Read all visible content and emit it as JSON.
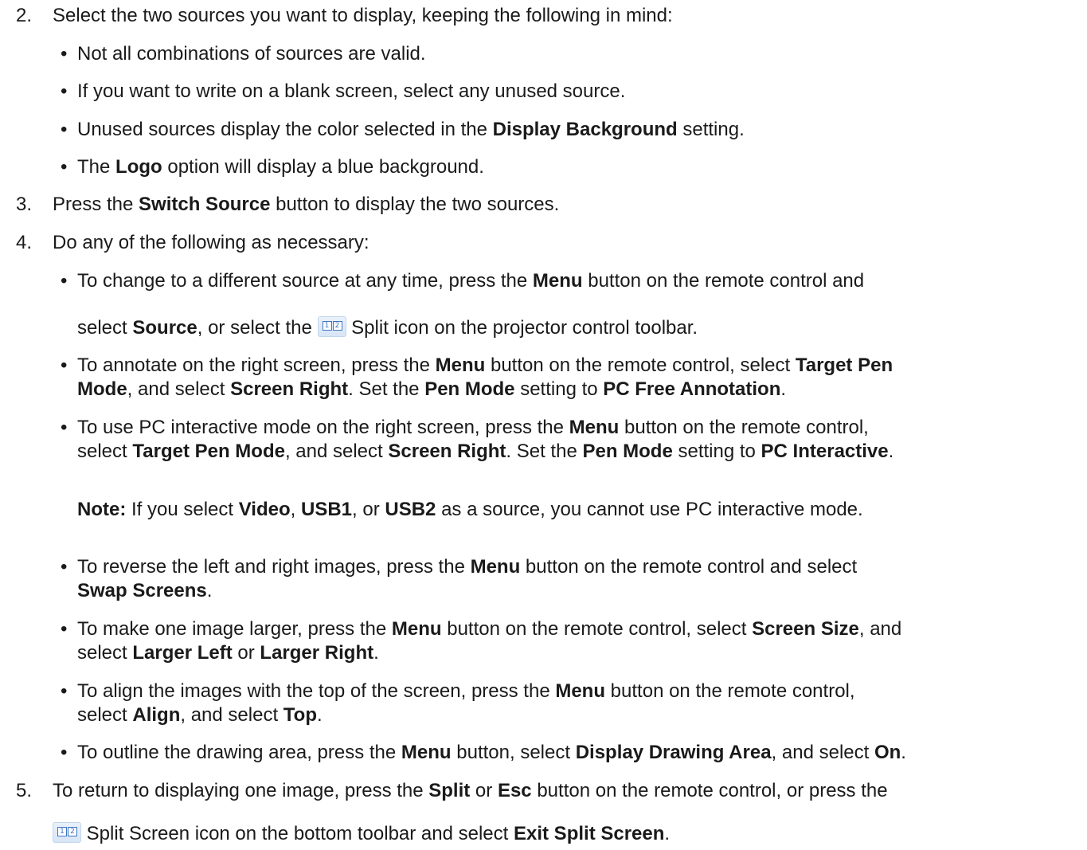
{
  "steps": [
    {
      "number": "2.",
      "parts": [
        {
          "t": "Select the two sources you want to display, keeping the following in mind:"
        }
      ]
    },
    {
      "number": "3.",
      "parts": [
        {
          "t": "Press the "
        },
        {
          "t": "Switch Source",
          "b": true
        },
        {
          "t": " button to display the two sources."
        }
      ]
    },
    {
      "number": "4.",
      "parts": [
        {
          "t": "Do any of the following as necessary:"
        }
      ]
    },
    {
      "number": "5.",
      "parts": [
        {
          "t": "To return to displaying one image, press the "
        },
        {
          "t": "Split",
          "b": true
        },
        {
          "t": " or "
        },
        {
          "t": "Esc",
          "b": true
        },
        {
          "t": " button on the remote control, or press the"
        }
      ]
    }
  ],
  "step2_bullets": [
    {
      "parts": [
        {
          "t": "Not all combinations of sources are valid."
        }
      ]
    },
    {
      "parts": [
        {
          "t": "If you want to write on a blank screen, select any unused source."
        }
      ]
    },
    {
      "parts": [
        {
          "t": "Unused sources display the color selected in the "
        },
        {
          "t": "Display Background",
          "b": true
        },
        {
          "t": " setting."
        }
      ]
    },
    {
      "parts": [
        {
          "t": "The "
        },
        {
          "t": "Logo",
          "b": true
        },
        {
          "t": " option will display a blue background."
        }
      ]
    }
  ],
  "step4_bullets": {
    "b1": {
      "line1": [
        {
          "t": "To change to a different source at any time, press the "
        },
        {
          "t": "Menu",
          "b": true
        },
        {
          "t": " button on the remote control and"
        }
      ],
      "line2a": [
        {
          "t": "select "
        },
        {
          "t": "Source",
          "b": true
        },
        {
          "t": ", or select the"
        }
      ],
      "line2b": [
        {
          "t": "Split icon on the projector control toolbar."
        }
      ]
    },
    "b2": {
      "line1": [
        {
          "t": "To annotate on the right screen, press the "
        },
        {
          "t": "Menu",
          "b": true
        },
        {
          "t": " button on the remote control, select "
        },
        {
          "t": "Target Pen",
          "b": true
        }
      ],
      "line2": [
        {
          "t": "Mode",
          "b": true
        },
        {
          "t": ", and select "
        },
        {
          "t": "Screen Right",
          "b": true
        },
        {
          "t": ". Set the "
        },
        {
          "t": "Pen Mode",
          "b": true
        },
        {
          "t": " setting to "
        },
        {
          "t": "PC Free Annotation",
          "b": true
        },
        {
          "t": "."
        }
      ]
    },
    "b3": {
      "line1": [
        {
          "t": "To use PC interactive mode on the right screen, press the "
        },
        {
          "t": "Menu",
          "b": true
        },
        {
          "t": " button on the remote control,"
        }
      ],
      "line2": [
        {
          "t": "select "
        },
        {
          "t": "Target Pen Mode",
          "b": true
        },
        {
          "t": ", and select "
        },
        {
          "t": "Screen Right",
          "b": true
        },
        {
          "t": ". Set the "
        },
        {
          "t": "Pen Mode",
          "b": true
        },
        {
          "t": " setting to "
        },
        {
          "t": "PC Interactive",
          "b": true
        },
        {
          "t": "."
        }
      ]
    },
    "note": [
      {
        "t": "Note:",
        "b": true
      },
      {
        "t": " If you select "
      },
      {
        "t": "Video",
        "b": true
      },
      {
        "t": ", "
      },
      {
        "t": "USB1",
        "b": true
      },
      {
        "t": ", or "
      },
      {
        "t": "USB2",
        "b": true
      },
      {
        "t": " as a source, you cannot use PC interactive mode."
      }
    ],
    "b4": {
      "line1": [
        {
          "t": "To reverse the left and right images, press the "
        },
        {
          "t": "Menu",
          "b": true
        },
        {
          "t": " button on the remote control and select"
        }
      ],
      "line2": [
        {
          "t": "Swap Screens",
          "b": true
        },
        {
          "t": "."
        }
      ]
    },
    "b5": {
      "line1": [
        {
          "t": "To make one image larger, press the "
        },
        {
          "t": "Menu",
          "b": true
        },
        {
          "t": " button on the remote control, select "
        },
        {
          "t": "Screen Size",
          "b": true
        },
        {
          "t": ", and"
        }
      ],
      "line2": [
        {
          "t": "select "
        },
        {
          "t": "Larger Left",
          "b": true
        },
        {
          "t": " or "
        },
        {
          "t": "Larger Right",
          "b": true
        },
        {
          "t": "."
        }
      ]
    },
    "b6": {
      "line1": [
        {
          "t": "To align the images with the top of the screen, press the "
        },
        {
          "t": "Menu",
          "b": true
        },
        {
          "t": " button on the remote control,"
        }
      ],
      "line2": [
        {
          "t": "select "
        },
        {
          "t": "Align",
          "b": true
        },
        {
          "t": ", and select "
        },
        {
          "t": "Top",
          "b": true
        },
        {
          "t": "."
        }
      ]
    },
    "b7": {
      "line1": [
        {
          "t": "To outline the drawing area, press the "
        },
        {
          "t": "Menu",
          "b": true
        },
        {
          "t": " button, select "
        },
        {
          "t": "Display Drawing Area",
          "b": true
        },
        {
          "t": ", and select "
        },
        {
          "t": "On",
          "b": true
        },
        {
          "t": "."
        }
      ]
    }
  },
  "step5_line2": [
    {
      "t": "Split Screen icon on the bottom toolbar and select "
    },
    {
      "t": "Exit Split Screen",
      "b": true
    },
    {
      "t": "."
    }
  ],
  "icons": {
    "split_pane_left": "1",
    "split_pane_right": "2",
    "bullet_char": "•"
  }
}
